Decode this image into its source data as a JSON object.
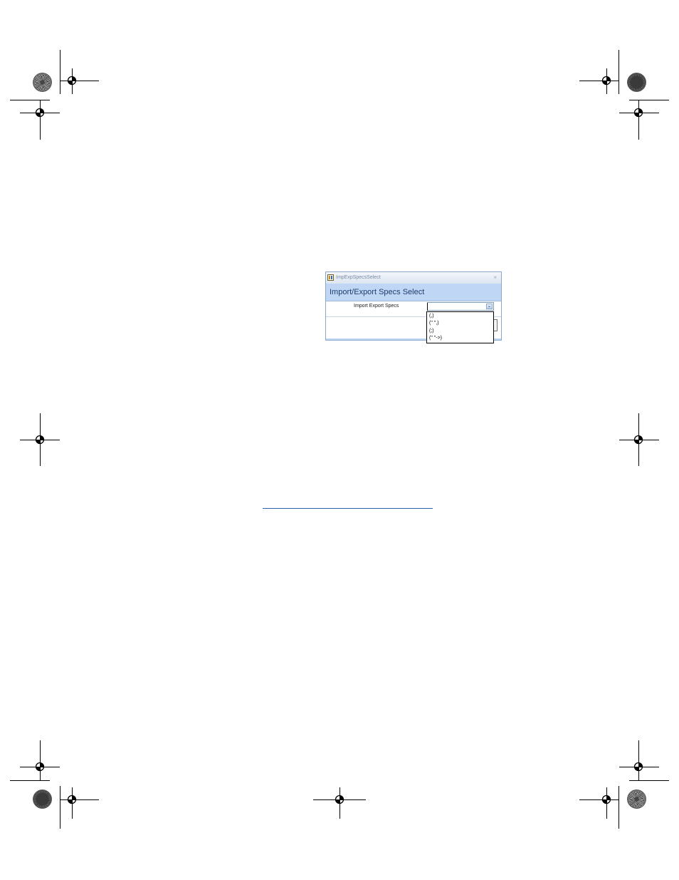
{
  "window": {
    "title": "ImpExpSpecsSelect",
    "close_glyph": "×"
  },
  "form": {
    "header_title": "Import/Export Specs Select",
    "field_label": "Import Export Specs",
    "combo_value": "",
    "combo_button_glyph": "⌄"
  },
  "dropdown": {
    "options": [
      "(,)",
      "(\" \",)",
      "(;)",
      "(\" \"->)"
    ]
  },
  "icons": {
    "app": "table-icon",
    "registration": "registration-mark-icon",
    "color_bar": "sunburst-icon"
  },
  "colors": {
    "header_bg": "#bfd7f4",
    "header_text": "#1e3d6e",
    "border": "#8aa7cc",
    "link_underline": "#2f5fb3"
  }
}
